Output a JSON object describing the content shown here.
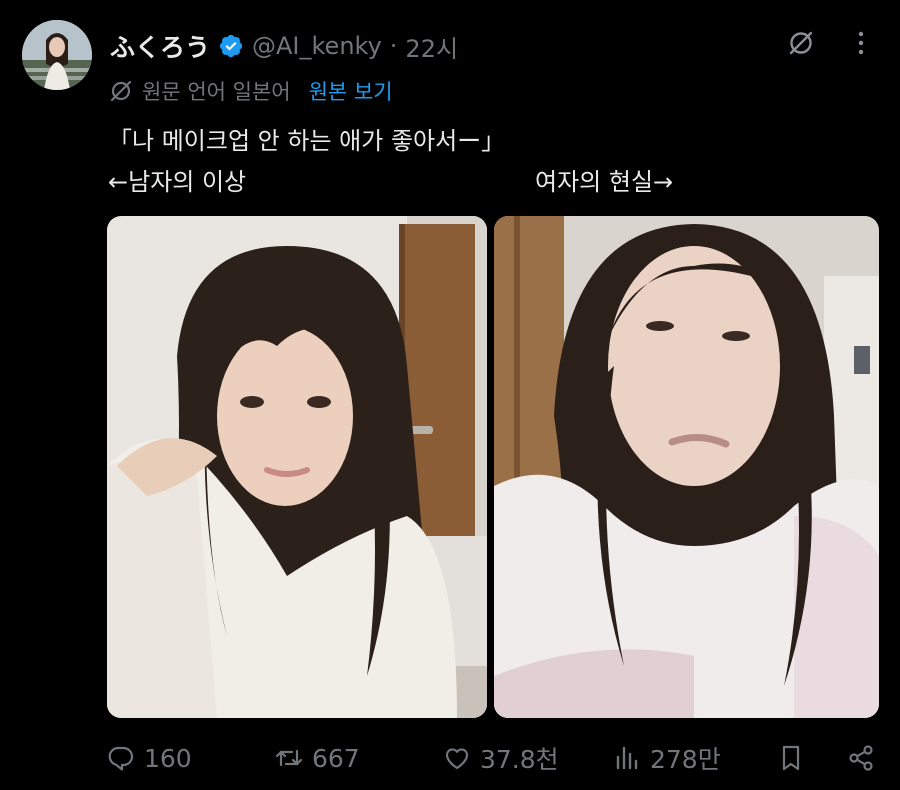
{
  "author": {
    "display_name": "ふくろう",
    "handle": "@AI_kenky",
    "separator": "·",
    "time": "22시",
    "verified": true
  },
  "translation": {
    "note": "원문 언어 일본어",
    "show_original": "원본 보기"
  },
  "text": {
    "line1": "「나 메이크업 안 하는 애가 좋아서ー」",
    "caption_left": "←남자의 이상",
    "caption_right": "여자의 현실→"
  },
  "media": [
    {
      "alt": "left photo"
    },
    {
      "alt": "right photo"
    }
  ],
  "actions": {
    "replies": "160",
    "reposts": "667",
    "likes": "37.8천",
    "views": "278만"
  },
  "colors": {
    "background": "#000000",
    "text": "#e7e9ea",
    "muted": "#71767b",
    "accent": "#1d9bf0"
  },
  "icons": [
    "translate-off-icon",
    "more-icon",
    "reply-icon",
    "repost-icon",
    "like-icon",
    "views-icon",
    "bookmark-icon",
    "share-icon",
    "verified-badge-icon"
  ]
}
